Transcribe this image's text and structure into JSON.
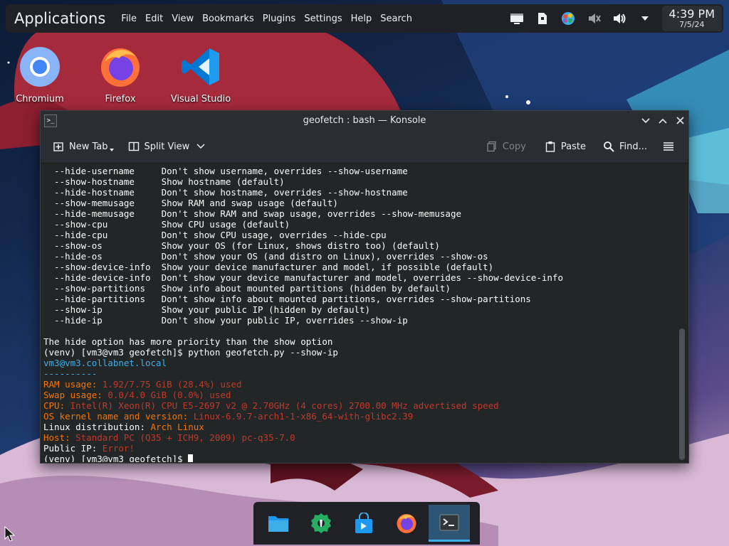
{
  "top_panel": {
    "launcher": "Applications",
    "menu": [
      "File",
      "Edit",
      "View",
      "Bookmarks",
      "Plugins",
      "Settings",
      "Help",
      "Search"
    ],
    "clock": {
      "time": "4:39 PM",
      "date": "7/5/24"
    },
    "tray_icons": [
      "display-configuration-icon",
      "vault-icon",
      "color-picker-icon",
      "microphone-muted-icon",
      "volume-icon",
      "expand-tray-icon"
    ]
  },
  "desktop": {
    "icons": [
      {
        "label": "Chromium",
        "icon": "chromium-icon"
      },
      {
        "label": "Firefox",
        "icon": "firefox-icon"
      },
      {
        "label": "Visual Studio Code",
        "icon": "vscode-icon"
      }
    ]
  },
  "window": {
    "title": "geofetch : bash — Konsole",
    "toolbar": {
      "new_tab": "New Tab",
      "split_view": "Split View",
      "copy": "Copy",
      "paste": "Paste",
      "find": "Find..."
    }
  },
  "terminal": {
    "lines": [
      [
        {
          "t": "  --hide-username     Don't show username, overrides --show-username",
          "c": "default"
        }
      ],
      [
        {
          "t": "  --show-hostname     Show hostname (default)",
          "c": "default"
        }
      ],
      [
        {
          "t": "  --hide-hostname     Don't show hostname, overrides --show-hostname",
          "c": "default"
        }
      ],
      [
        {
          "t": "  --show-memusage     Show RAM and swap usage (default)",
          "c": "default"
        }
      ],
      [
        {
          "t": "  --hide-memusage     Don't show RAM and swap usage, overrides --show-memusage",
          "c": "default"
        }
      ],
      [
        {
          "t": "  --show-cpu          Show CPU usage (default)",
          "c": "default"
        }
      ],
      [
        {
          "t": "  --hide-cpu          Don't show CPU usage, overrides --hide-cpu",
          "c": "default"
        }
      ],
      [
        {
          "t": "  --show-os           Show your OS (for Linux, shows distro too) (default)",
          "c": "default"
        }
      ],
      [
        {
          "t": "  --hide-os           Don't show your OS (and distro on Linux), overrides --show-os",
          "c": "default"
        }
      ],
      [
        {
          "t": "  --show-device-info  Show your device manufacturer and model, if possible (default)",
          "c": "default"
        }
      ],
      [
        {
          "t": "  --hide-device-info  Don't show your device manufacturer and model, overrides --show-device-info",
          "c": "default"
        }
      ],
      [
        {
          "t": "  --show-partitions   Show info about mounted partitions (hidden by default)",
          "c": "default"
        }
      ],
      [
        {
          "t": "  --hide-partitions   Don't show info about mounted partitions, overrides --show-partitions",
          "c": "default"
        }
      ],
      [
        {
          "t": "  --show-ip           Show your public IP (hidden by default)",
          "c": "default"
        }
      ],
      [
        {
          "t": "  --hide-ip           Don't show your public IP, overrides --show-ip",
          "c": "default"
        }
      ],
      [
        {
          "t": "",
          "c": "default"
        }
      ],
      [
        {
          "t": "The hide option has more priority than the show option",
          "c": "default"
        }
      ],
      [
        {
          "t": "(venv) [vm3@vm3 geofetch]$ python geofetch.py --show-ip",
          "c": "default"
        }
      ],
      [
        {
          "t": "vm3@vm3.collabnet.local",
          "c": "blue"
        }
      ],
      [
        {
          "t": "----------",
          "c": "blue"
        }
      ],
      [
        {
          "t": "RAM usage: ",
          "c": "orange"
        },
        {
          "t": "1.92/7.75 GiB (28.4%) used",
          "c": "red"
        }
      ],
      [
        {
          "t": "Swap usage: ",
          "c": "orange"
        },
        {
          "t": "0.0/4.0 GiB (0.0%) used",
          "c": "red"
        }
      ],
      [
        {
          "t": "CPU: ",
          "c": "orange"
        },
        {
          "t": "Intel(R) Xeon(R) CPU E5-2697 v2 @ 2.70GHz (4 cores) 2700.00 MHz advertised speed",
          "c": "red"
        }
      ],
      [
        {
          "t": "OS kernel name and version: ",
          "c": "orange"
        },
        {
          "t": "Linux-6.9.7-arch1-1-x86_64-with-glibc2.39",
          "c": "red"
        }
      ],
      [
        {
          "t": "Linux distribution: ",
          "c": "default"
        },
        {
          "t": "Arch Linux",
          "c": "orange"
        }
      ],
      [
        {
          "t": "Host: ",
          "c": "orange"
        },
        {
          "t": "Standard PC (Q35 + ICH9, 2009) pc-q35-7.0",
          "c": "red"
        }
      ],
      [
        {
          "t": "Public IP: ",
          "c": "default"
        },
        {
          "t": "Error!",
          "c": "red"
        }
      ],
      [
        {
          "t": "(venv) [vm3@vm3 geofetch]$ ",
          "c": "default"
        },
        {
          "t": "",
          "c": "cursor"
        }
      ]
    ]
  },
  "taskbar": {
    "items": [
      {
        "icon": "file-manager-icon",
        "active": false
      },
      {
        "icon": "system-settings-icon",
        "active": false
      },
      {
        "icon": "discover-store-icon",
        "active": false
      },
      {
        "icon": "firefox-icon",
        "active": false
      },
      {
        "icon": "konsole-icon",
        "active": true
      }
    ]
  },
  "colors": {
    "accent": "#3daee9",
    "orange": "#f67400",
    "red": "#c0392b",
    "terminal_bg": "#232627"
  }
}
